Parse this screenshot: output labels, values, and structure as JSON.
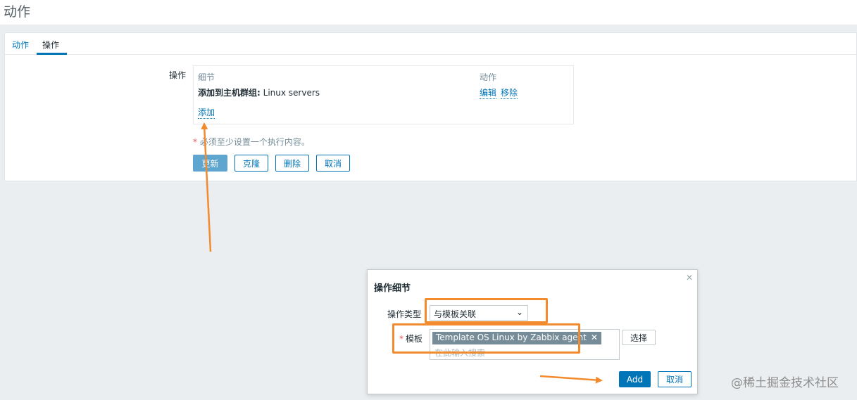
{
  "page": {
    "title": "动作"
  },
  "tabs": [
    {
      "label": "动作"
    },
    {
      "label": "操作"
    }
  ],
  "operations": {
    "label": "操作",
    "col_details": "细节",
    "col_actions": "动作",
    "row": {
      "title": "添加到主机群组:",
      "value": "Linux servers",
      "edit": "编辑",
      "remove": "移除"
    },
    "add_link": "添加"
  },
  "required_note": {
    "star": "*",
    "text": "必须至少设置一个执行内容。"
  },
  "buttons": {
    "update": "更新",
    "clone": "克隆",
    "delete": "删除",
    "cancel": "取消"
  },
  "dialog": {
    "title": "操作细节",
    "close_icon": "✕",
    "op_type_label": "操作类型",
    "op_type_value": "与模板关联",
    "template_label": "模板",
    "template_star": "*",
    "template_tag": "Template OS Linux by Zabbix agent",
    "template_tag_remove": "✕",
    "template_placeholder": "在此输入搜索",
    "select_button": "选择",
    "add_button": "Add",
    "cancel_button": "取消"
  },
  "watermark": "@稀土掘金技术社区",
  "colors": {
    "accent": "#0275b8",
    "annotation": "#f28a2e",
    "required": "#e45959"
  }
}
